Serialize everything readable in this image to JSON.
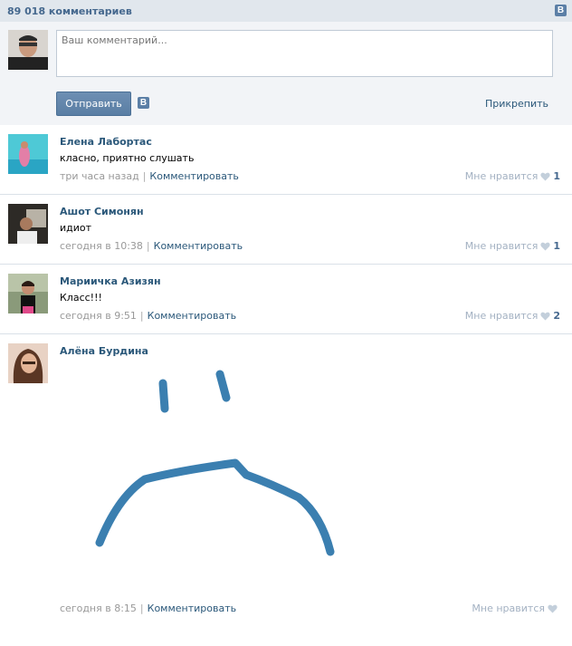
{
  "header": {
    "title": "89 018 комментариев",
    "logo": "В"
  },
  "compose": {
    "placeholder": "Ваш комментарий...",
    "send_label": "Отправить",
    "logo": "В",
    "attach_label": "Прикрепить"
  },
  "comments": [
    {
      "author": "Елена Лабортас",
      "text": "класно, приятно слушать",
      "time": "три часа назад",
      "reply": "Комментировать",
      "like_label": "Мне нравится",
      "likes": "1"
    },
    {
      "author": "Ашот Симонян",
      "text": "идиот",
      "time": "сегодня в 10:38",
      "reply": "Комментировать",
      "like_label": "Мне нравится",
      "likes": "1"
    },
    {
      "author": "Мариичка Азизян",
      "text": "Класс!!!",
      "time": "сегодня в 9:51",
      "reply": "Комментировать",
      "like_label": "Мне нравится",
      "likes": "2"
    },
    {
      "author": "Алёна Бурдина",
      "text": "",
      "time": "сегодня в 8:15",
      "reply": "Комментировать",
      "like_label": "Мне нравится",
      "likes": ""
    }
  ],
  "colors": {
    "link": "#2b587a",
    "header_bg": "#e1e7ed",
    "button": "#5e82a8",
    "sad_face": "#3b7fb0"
  }
}
